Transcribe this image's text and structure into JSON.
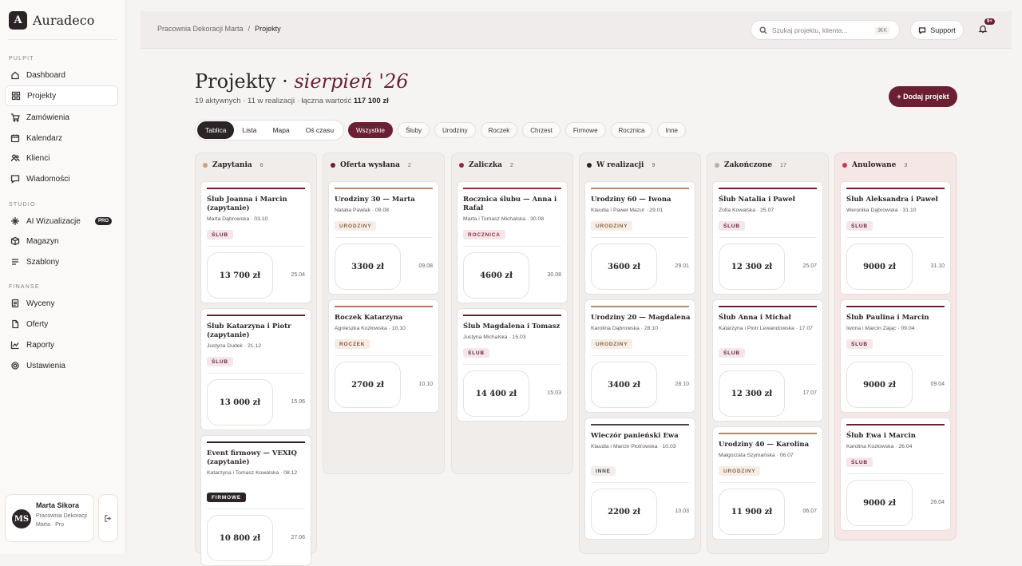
{
  "app": {
    "name": "Auradeco",
    "logo_letter": "A"
  },
  "sidebar": {
    "pulpit_label": "PULPIT",
    "studio_label": "STUDIO",
    "finanse_label": "FINANSE",
    "pro_badge": "PRO",
    "items": [
      {
        "label": "Dashboard",
        "icon": "home-icon"
      },
      {
        "label": "Projekty",
        "icon": "grid-icon"
      },
      {
        "label": "Zamówienia",
        "icon": "cart-icon"
      },
      {
        "label": "Kalendarz",
        "icon": "calendar-icon"
      },
      {
        "label": "Klienci",
        "icon": "users-icon"
      },
      {
        "label": "Wiadomości",
        "icon": "message-icon"
      },
      {
        "label": "AI Wizualizacje",
        "icon": "sparkle-icon"
      },
      {
        "label": "Magazyn",
        "icon": "box-icon"
      },
      {
        "label": "Szablony",
        "icon": "template-icon"
      },
      {
        "label": "Wyceny",
        "icon": "document-icon"
      },
      {
        "label": "Oferty",
        "icon": "file-icon"
      },
      {
        "label": "Raporty",
        "icon": "chart-icon"
      },
      {
        "label": "Ustawienia",
        "icon": "gear-icon"
      }
    ],
    "user": {
      "initials": "MS",
      "name": "Marta Sikora",
      "org": "Pracownia Dekoracji Marta · Pro"
    }
  },
  "topbar": {
    "crumb_1": "Pracownia Dekoracji Marta",
    "crumb_sep": "/",
    "crumb_2": "Projekty",
    "search_placeholder": "Szukaj projektu, klienta...",
    "search_kbd": "⌘K",
    "support": "Support",
    "notif_badge": "9+"
  },
  "page": {
    "title_main": "Projekty · ",
    "title_accent": "sierpień '26",
    "subtitle_text": "19 aktywnych · 11 w realizacji · łączna wartość ",
    "subtitle_value": "117 100 zł",
    "add_button": "+ Dodaj projekt"
  },
  "views": [
    "Tablica",
    "Lista",
    "Mapa",
    "Oś czasu"
  ],
  "filters": [
    "Wszystkie",
    "Śluby",
    "Urodziny",
    "Roczek",
    "Chrzest",
    "Firmowe",
    "Rocznica",
    "Inne"
  ],
  "colors": {
    "accent": "#6b1f33",
    "wedding": "#6b1f33",
    "birthday": "#b08968",
    "anniversary": "#8b2e3e",
    "first_birthday": "#b5745a",
    "corporate": "#2a2426",
    "other": "#4a4244"
  },
  "columns": [
    {
      "title": "Zapytania",
      "count": "6",
      "dot": "#c9a27e",
      "cards": [
        {
          "title": "Ślub Joanna i Marcin (zapytanie)",
          "meta": "Marta Dąbrowska · 03.10",
          "tag": "ŚLUB",
          "value": "13 700 zł",
          "date": "25.04"
        },
        {
          "title": "Ślub Katarzyna i Piotr (zapytanie)",
          "meta": "Justyna Dudek · 21.12",
          "tag": "ŚLUB",
          "value": "13 000 zł",
          "date": "15.06"
        },
        {
          "title": "Event firmowy — VEXIQ (zapytanie)",
          "meta": "Katarzyna i Tomasz Kowalska · 08.12",
          "tag": "FIRMOWE",
          "value": "10 800 zł",
          "date": "27.06"
        }
      ]
    },
    {
      "title": "Oferta wysłana",
      "count": "2",
      "dot": "#6b1f33",
      "cards": [
        {
          "title": "Urodziny 30 — Marta",
          "meta": "Natalia Pawlak · 09.08",
          "tag": "URODZINY",
          "value": "3300 zł",
          "date": "09.08"
        },
        {
          "title": "Roczek Katarzyna",
          "meta": "Agnieszka Kozłowska · 10.10",
          "tag": "ROCZEK",
          "value": "2700 zł",
          "date": "10.10"
        }
      ]
    },
    {
      "title": "Zaliczka",
      "count": "2",
      "dot": "#8b2e3e",
      "cards": [
        {
          "title": "Rocznica ślubu — Anna i Rafał",
          "meta": "Marta i Tomasz Michalska · 30.08",
          "tag": "ROCZNICA",
          "value": "4600 zł",
          "date": "30.08"
        },
        {
          "title": "Ślub Magdalena i Tomasz",
          "meta": "Justyna Michalska · 15.03",
          "tag": "ŚLUB",
          "value": "14 400 zł",
          "date": "15.03"
        }
      ]
    },
    {
      "title": "W realizacji",
      "count": "9",
      "dot": "#2a2426",
      "cards": [
        {
          "title": "Urodziny 60 — Iwona",
          "meta": "Klaudia i Paweł Mazur · 29.01",
          "tag": "URODZINY",
          "value": "3600 zł",
          "date": "29.01"
        },
        {
          "title": "Urodziny 20 — Magdalena",
          "meta": "Karolina Dąbrowska · 28.10",
          "tag": "URODZINY",
          "value": "3400 zł",
          "date": "28.10"
        },
        {
          "title": "Wieczór panieński Ewa",
          "meta": "Klaudia i Marcin Piotrowska · 10.03",
          "tag": "INNE",
          "value": "2200 zł",
          "date": "10.03"
        }
      ]
    },
    {
      "title": "Zakończone",
      "count": "17",
      "dot": "#b8b0ab",
      "cards": [
        {
          "title": "Ślub Natalia i Paweł",
          "meta": "Zofia Kowalska · 25.07",
          "tag": "ŚLUB",
          "value": "12 300 zł",
          "date": "25.07"
        },
        {
          "title": "Ślub Anna i Michał",
          "meta": "Katarzyna i Piotr Lewandowska · 17.07",
          "tag": "ŚLUB",
          "value": "12 300 zł",
          "date": "17.07"
        },
        {
          "title": "Urodziny 40 — Karolina",
          "meta": "Małgorzata Szymańska · 06.07",
          "tag": "URODZINY",
          "value": "11 900 zł",
          "date": "06.07"
        }
      ]
    },
    {
      "title": "Anulowane",
      "count": "3",
      "dot": "#c0404a",
      "cards": [
        {
          "title": "Ślub Aleksandra i Paweł",
          "meta": "Weronika Dąbrowska · 31.10",
          "tag": "ŚLUB",
          "value": "9000 zł",
          "date": "31.10"
        },
        {
          "title": "Ślub Paulina i Marcin",
          "meta": "Iwona i Marcin Zając · 09.04",
          "tag": "ŚLUB",
          "value": "9000 zł",
          "date": "09.04"
        },
        {
          "title": "Ślub Ewa i Marcin",
          "meta": "Karolina Kozłowska · 26.04",
          "tag": "ŚLUB",
          "value": "9000 zł",
          "date": "26.04"
        }
      ]
    }
  ]
}
